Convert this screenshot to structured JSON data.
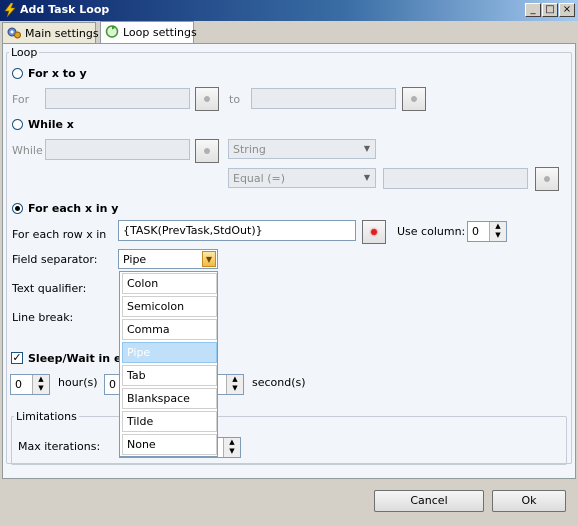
{
  "window": {
    "title": "Add Task Loop",
    "icon": "lightning-icon"
  },
  "controls": {
    "minimize": "_",
    "maximize": "□",
    "close": "×"
  },
  "tabs": [
    {
      "label": "Main settings",
      "icon": "gears-icon"
    },
    {
      "label": "Loop settings",
      "icon": "loop-arrows-icon"
    }
  ],
  "loop_group": {
    "legend": "Loop"
  },
  "for_x_to_y": {
    "label": "For x to y",
    "for_label": "For",
    "to_label": "to",
    "for_value": "",
    "to_value": ""
  },
  "while_x": {
    "label": "While x",
    "while_label": "While",
    "value": "",
    "type": "String",
    "operator": "Equal (=)",
    "compare_value": ""
  },
  "for_each": {
    "label": "For each x in y",
    "row_label": "For each row x in",
    "row_value": "{TASK(PrevTask,StdOut)}",
    "use_column_label": "Use column:",
    "use_column_value": "0",
    "field_separator_label": "Field separator:",
    "field_separator_value": "Pipe",
    "text_qualifier_label": "Text qualifier:",
    "line_break_label": "Line break:"
  },
  "separator_options": [
    "Colon",
    "Semicolon",
    "Comma",
    "Pipe",
    "Tab",
    "Blankspace",
    "Tilde",
    "None"
  ],
  "selected_option": "Pipe",
  "sleep": {
    "label": "Sleep/Wait in ea",
    "checked": true,
    "hours_value": "0",
    "hours_label": "hour(s)",
    "minutes_value": "0",
    "seconds_label": "second(s)"
  },
  "limitations": {
    "legend": "Limitations",
    "max_iterations_label": "Max iterations:"
  },
  "buttons": {
    "cancel": "Cancel",
    "ok": "Ok"
  }
}
